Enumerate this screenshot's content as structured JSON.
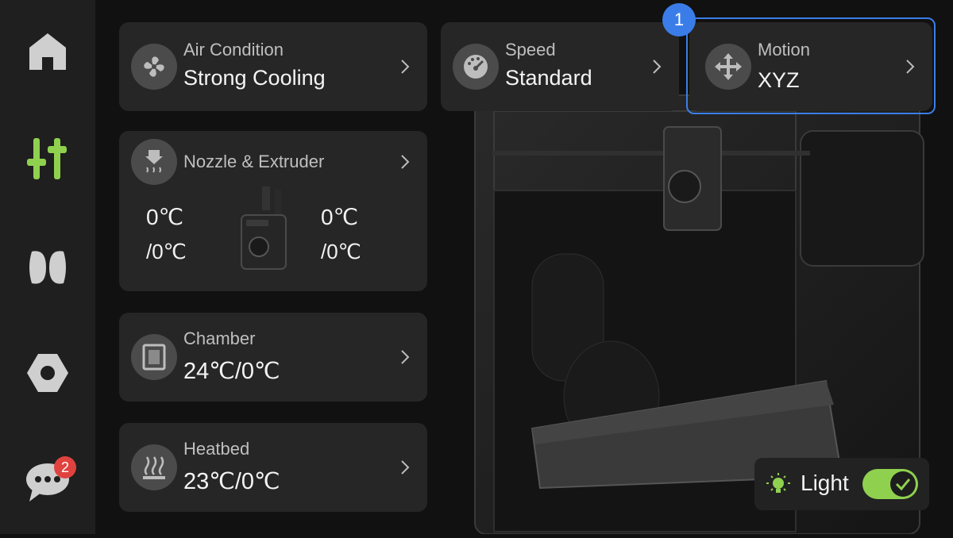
{
  "sidebar": {
    "items": [
      {
        "name": "home",
        "icon": "home-icon"
      },
      {
        "name": "controls",
        "icon": "sliders-icon",
        "active": true
      },
      {
        "name": "filament",
        "icon": "filament-spool-icon"
      },
      {
        "name": "settings",
        "icon": "hex-nut-icon"
      },
      {
        "name": "messages",
        "icon": "chat-bubble-icon",
        "badge": "2"
      }
    ]
  },
  "cards": {
    "air": {
      "label": "Air Condition",
      "value": "Strong Cooling",
      "icon": "fan-icon"
    },
    "speed": {
      "label": "Speed",
      "value": "Standard",
      "icon": "speedometer-icon"
    },
    "motion": {
      "label": "Motion",
      "value": "XYZ",
      "icon": "move-arrows-icon"
    },
    "nozzle": {
      "label": "Nozzle & Extruder",
      "icon": "nozzle-heat-icon",
      "left_current": "0℃",
      "left_target": "/0℃",
      "right_current": "0℃",
      "right_target": "/0℃"
    },
    "chamber": {
      "label": "Chamber",
      "value": "24℃/0℃",
      "icon": "chamber-heater-icon"
    },
    "heatbed": {
      "label": "Heatbed",
      "value": "23℃/0℃",
      "icon": "heatbed-icon"
    }
  },
  "highlight": {
    "step": "1"
  },
  "light": {
    "label": "Light",
    "on": true,
    "icon": "lightbulb-icon"
  },
  "colors": {
    "accent": "#8fd14f",
    "highlight": "#3b7de8",
    "badge": "#e0433f"
  }
}
